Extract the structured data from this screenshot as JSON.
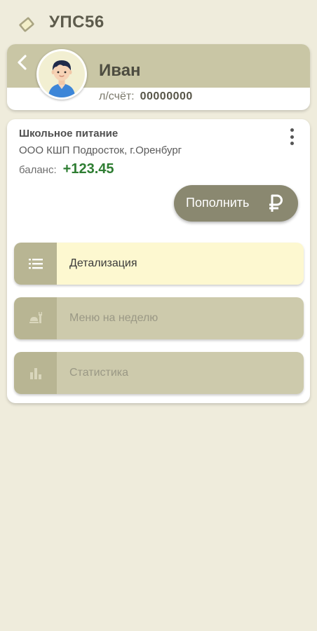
{
  "app": {
    "title": "УПС56",
    "icon": "card-icon"
  },
  "profile": {
    "name": "Иван",
    "account_label": "л/счёт:",
    "account_number": "00000000",
    "back_icon": "chevron-left-icon",
    "avatar_icon": "boy-avatar"
  },
  "service": {
    "title": "Школьное питание",
    "organization": "ООО КШП Подросток, г.Оренбург",
    "balance_label": "баланс:",
    "balance_value": "+123.45",
    "menu_icon": "more-vert-icon",
    "topup_label": "Пополнить",
    "topup_icon": "ruble-icon"
  },
  "actions": [
    {
      "label": "Детализация",
      "icon": "list-icon",
      "state": "active"
    },
    {
      "label": "Меню на неделю",
      "icon": "food-icon",
      "state": "disabled"
    },
    {
      "label": "Статистика",
      "icon": "bar-chart-icon",
      "state": "disabled"
    }
  ],
  "colors": {
    "background": "#efecdc",
    "accent": "#c9c6a5",
    "button": "#8a8870",
    "balance_positive": "#2e7d32",
    "active_item": "#fdf8d0"
  }
}
